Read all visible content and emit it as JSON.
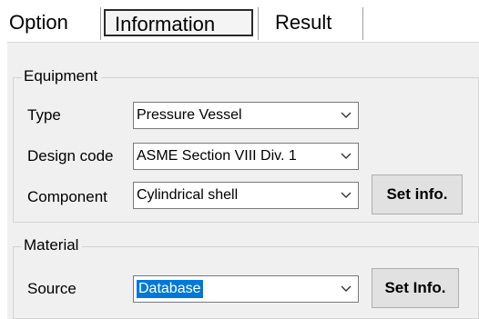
{
  "tabs": [
    {
      "label": "Option"
    },
    {
      "label": "Information",
      "active": true
    },
    {
      "label": "Result"
    }
  ],
  "equipment": {
    "title": "Equipment",
    "type_label": "Type",
    "type_value": "Pressure Vessel",
    "design_code_label": "Design code",
    "design_code_value": "ASME Section VIII Div. 1",
    "component_label": "Component",
    "component_value": "Cylindrical shell",
    "set_info_label": "Set info."
  },
  "material": {
    "title": "Material",
    "source_label": "Source",
    "source_value": "Database",
    "set_info_label": "Set Info."
  },
  "icons": {
    "dropdown": "chevron-down-icon"
  }
}
